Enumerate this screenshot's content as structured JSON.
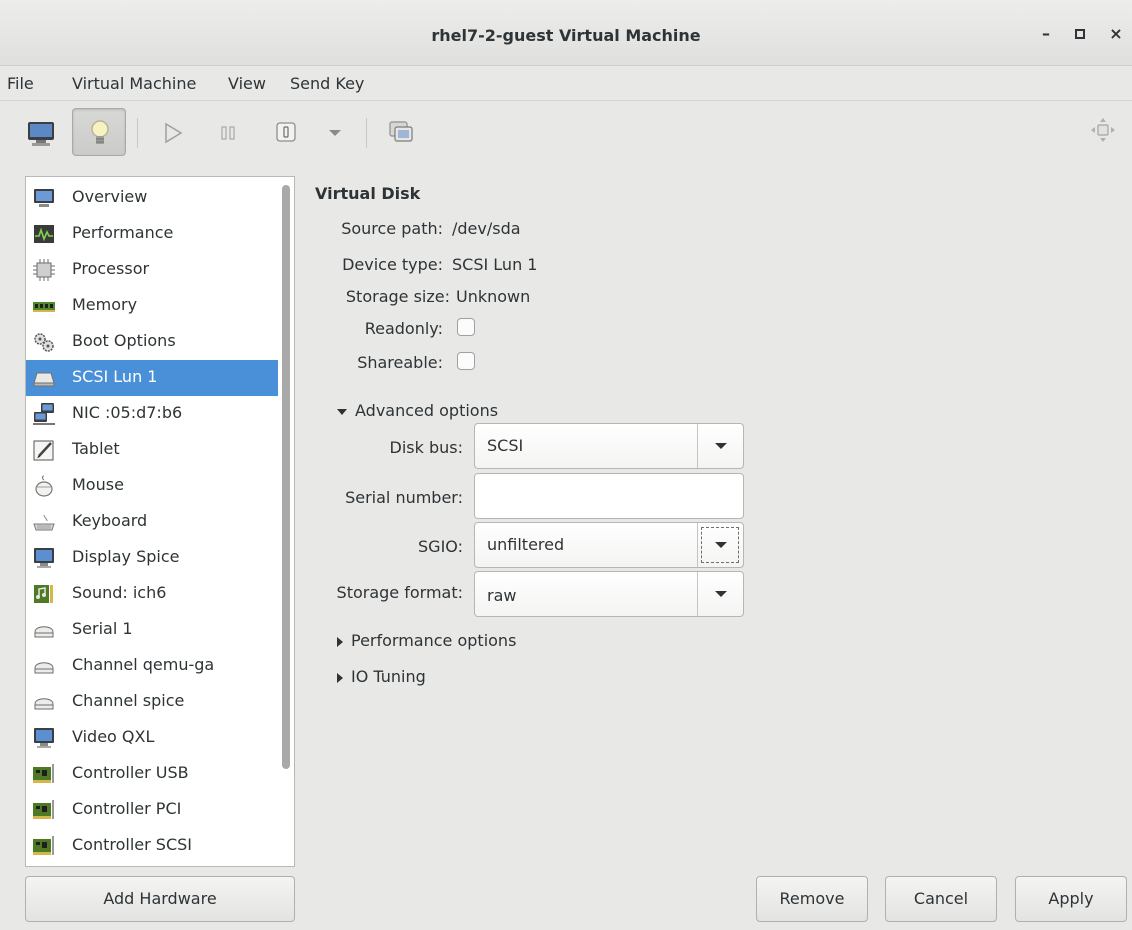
{
  "window": {
    "title": "rhel7-2-guest Virtual Machine",
    "minimize": "–",
    "maximize": "□",
    "close": "×"
  },
  "menu": {
    "items": [
      "File",
      "Virtual Machine",
      "View",
      "Send Key"
    ]
  },
  "toolbar": {
    "buttons": [
      "monitor-icon",
      "lightbulb-icon",
      "play-icon",
      "pause-icon",
      "power-icon",
      "dropdown-icon",
      "snapshot-icon",
      "fullscreen-icon"
    ],
    "active": "lightbulb-icon"
  },
  "sidebar": {
    "selected_index": 5,
    "items": [
      {
        "label": "Overview",
        "icon": "overview-icon"
      },
      {
        "label": "Performance",
        "icon": "performance-icon"
      },
      {
        "label": "Processor",
        "icon": "processor-icon"
      },
      {
        "label": "Memory",
        "icon": "memory-icon"
      },
      {
        "label": "Boot Options",
        "icon": "boot-options-icon"
      },
      {
        "label": "SCSI Lun 1",
        "icon": "disk-icon"
      },
      {
        "label": "NIC :05:d7:b6",
        "icon": "nic-icon"
      },
      {
        "label": "Tablet",
        "icon": "tablet-icon"
      },
      {
        "label": "Mouse",
        "icon": "mouse-icon"
      },
      {
        "label": "Keyboard",
        "icon": "keyboard-icon"
      },
      {
        "label": "Display Spice",
        "icon": "display-icon"
      },
      {
        "label": "Sound: ich6",
        "icon": "sound-icon"
      },
      {
        "label": "Serial 1",
        "icon": "serial-icon"
      },
      {
        "label": "Channel qemu-ga",
        "icon": "channel-icon"
      },
      {
        "label": "Channel spice",
        "icon": "channel-icon"
      },
      {
        "label": "Video QXL",
        "icon": "video-icon"
      },
      {
        "label": "Controller USB",
        "icon": "controller-icon"
      },
      {
        "label": "Controller PCI",
        "icon": "controller-icon"
      },
      {
        "label": "Controller SCSI",
        "icon": "controller-icon"
      }
    ],
    "add_hardware": "Add Hardware"
  },
  "details": {
    "title": "Virtual Disk",
    "source_path_label": "Source path:",
    "source_path_value": "/dev/sda",
    "device_type_label": "Device type:",
    "device_type_value": "SCSI Lun 1",
    "storage_size_label": "Storage size:",
    "storage_size_value": "Unknown",
    "readonly_label": "Readonly:",
    "readonly_checked": false,
    "shareable_label": "Shareable:",
    "shareable_checked": false,
    "advanced_label": "Advanced options",
    "disk_bus_label": "Disk bus:",
    "disk_bus_value": "SCSI",
    "serial_label": "Serial number:",
    "serial_value": "",
    "sgio_label": "SGIO:",
    "sgio_value": "unfiltered",
    "storage_format_label": "Storage format:",
    "storage_format_value": "raw",
    "performance_label": "Performance options",
    "io_tuning_label": "IO Tuning"
  },
  "buttons": {
    "remove": "Remove",
    "cancel": "Cancel",
    "apply": "Apply"
  },
  "colors": {
    "selection": "#4a90d9",
    "window_bg": "#e8e8e7"
  }
}
